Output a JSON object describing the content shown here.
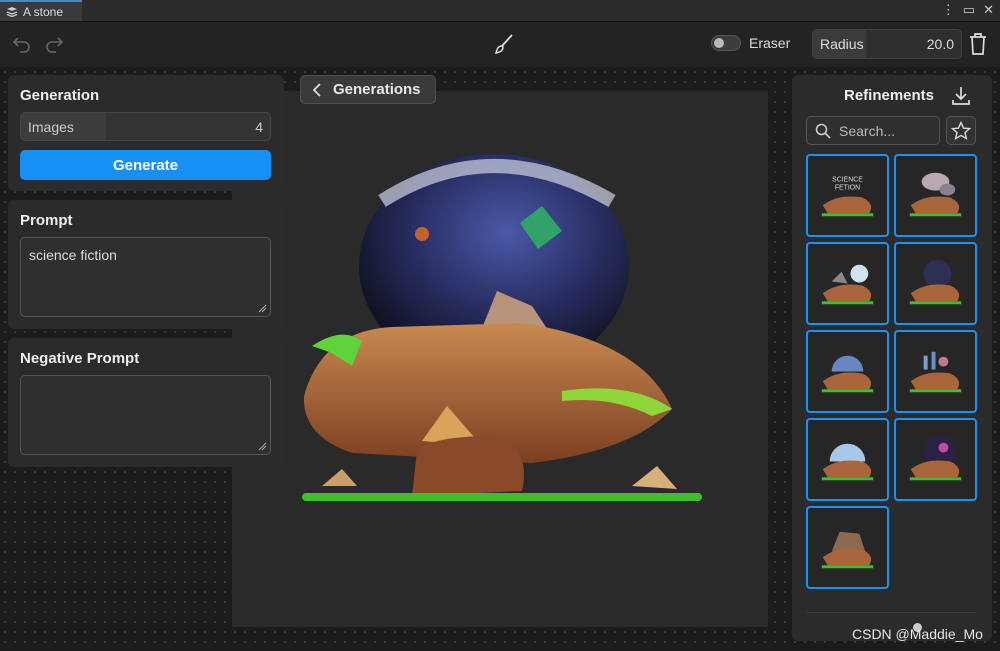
{
  "window": {
    "tab_title": "A stone",
    "controls": [
      "⋮",
      "▭",
      "✕"
    ]
  },
  "toolbar": {
    "undo_icon": "undo-icon",
    "redo_icon": "redo-icon",
    "brush_icon": "brush-icon",
    "eraser_label": "Eraser",
    "eraser_on": false,
    "radius_label": "Radius",
    "radius_value": "20.0",
    "trash_icon": "trash-icon"
  },
  "left": {
    "generation": {
      "title": "Generation",
      "images_label": "Images",
      "images_value": "4",
      "generate_label": "Generate"
    },
    "prompt": {
      "title": "Prompt",
      "value": "science fiction"
    },
    "negative_prompt": {
      "title": "Negative Prompt",
      "value": ""
    }
  },
  "center": {
    "back_label": "Generations"
  },
  "right": {
    "title": "Refinements",
    "search_placeholder": "Search...",
    "thumbnails": [
      {
        "overlay_text": [
          "SCIENCE",
          "FETION"
        ]
      },
      {
        "overlay_text": []
      },
      {
        "overlay_text": []
      },
      {
        "overlay_text": []
      },
      {
        "overlay_text": []
      },
      {
        "overlay_text": []
      },
      {
        "overlay_text": []
      },
      {
        "overlay_text": []
      },
      {
        "overlay_text": []
      }
    ]
  },
  "watermark": "CSDN @Maddie_Mo",
  "colors": {
    "accent": "#1790f5",
    "thumb_border": "#1e90f5",
    "panel": "#2b2b2b",
    "background": "#1b1b1b"
  }
}
